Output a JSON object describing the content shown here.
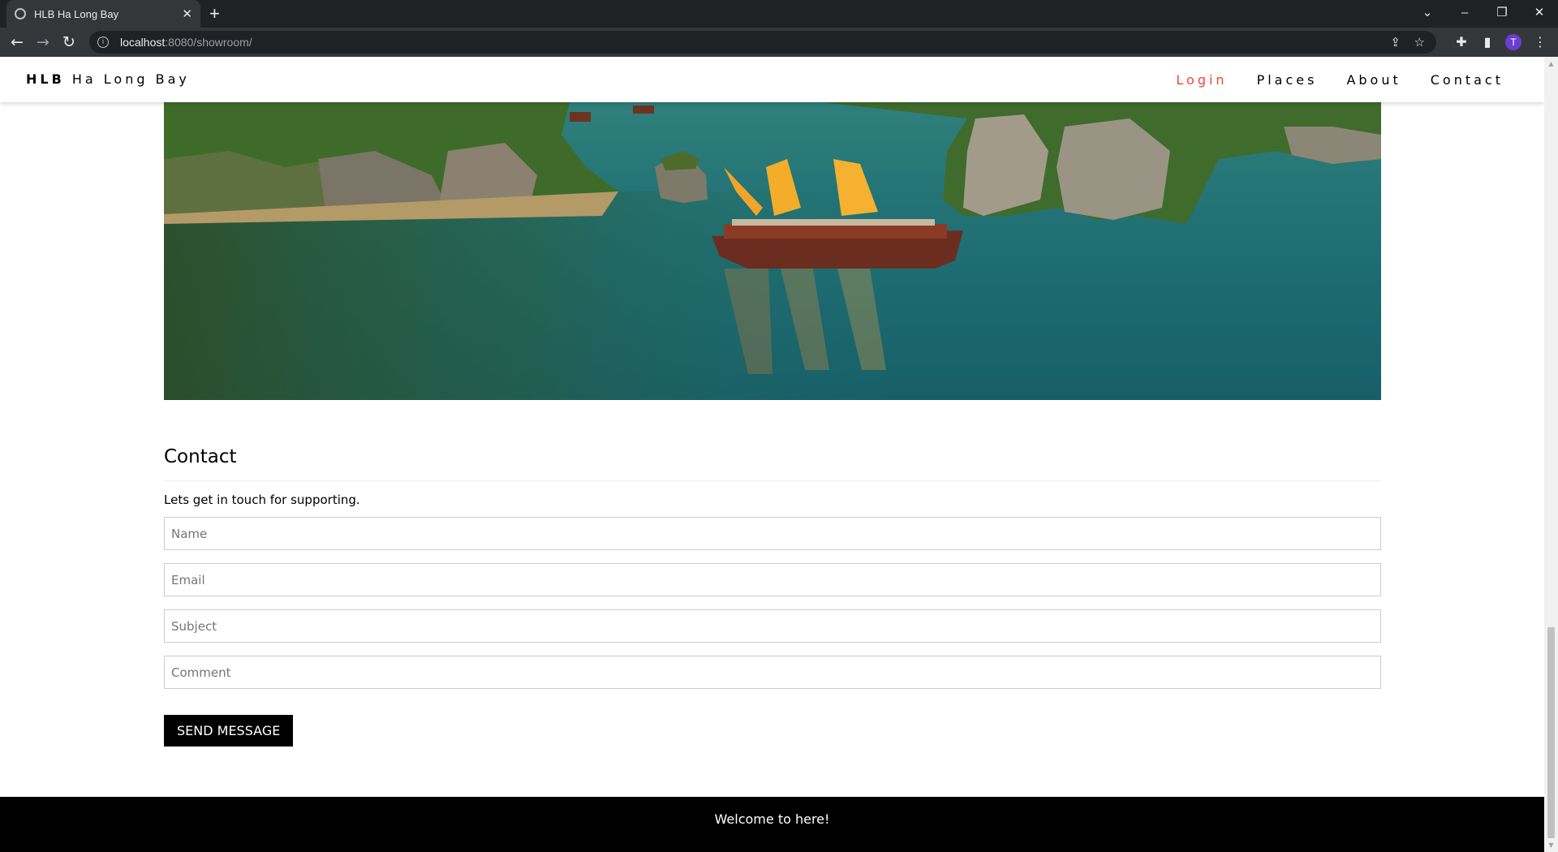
{
  "browser": {
    "tab_title": "HLB Ha Long Bay",
    "url_host": "localhost",
    "url_path": ":8080/showroom/",
    "profile_initial": "T"
  },
  "nav": {
    "brand_bold": "HLB",
    "brand_rest": "Ha Long Bay",
    "items": [
      {
        "label": "Login",
        "active": true
      },
      {
        "label": "Places",
        "active": false
      },
      {
        "label": "About",
        "active": false
      },
      {
        "label": "Contact",
        "active": false
      }
    ]
  },
  "contact": {
    "heading": "Contact",
    "intro": "Lets get in touch for supporting.",
    "fields": {
      "name": "Name",
      "email": "Email",
      "subject": "Subject",
      "comment": "Comment"
    },
    "submit_label": "SEND MESSAGE"
  },
  "footer": {
    "text": "Welcome to here!"
  },
  "colors": {
    "active_nav": "#f44336",
    "footer_bg": "#000000",
    "button_bg": "#000000"
  }
}
